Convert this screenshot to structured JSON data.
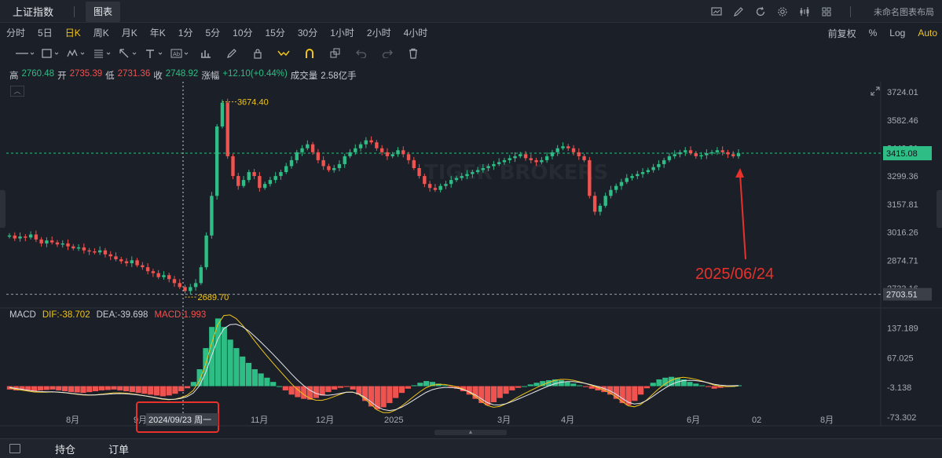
{
  "titlebar": {
    "app_title": "上证指数",
    "tab_chart": "图表",
    "layout_name": "未命名图表布局",
    "icons": [
      "screenshot-icon",
      "edit-icon",
      "refresh-icon",
      "settings-icon",
      "indicator-icon",
      "grid-icon"
    ]
  },
  "periods": {
    "items": [
      "分时",
      "5日",
      "日K",
      "周K",
      "月K",
      "年K",
      "1分",
      "5分",
      "10分",
      "15分",
      "30分",
      "1小时",
      "2小时",
      "4小时"
    ],
    "active": "日K",
    "adjust": "前复权",
    "percent": "%",
    "log": "Log",
    "auto": "Auto"
  },
  "quote": {
    "high_label": "高",
    "high": "2760.48",
    "open_label": "开",
    "open": "2735.39",
    "low_label": "低",
    "low": "2731.36",
    "close_label": "收",
    "close": "2748.92",
    "change_label": "涨幅",
    "change": "+12.10(+0.44%)",
    "volume_label": "成交量",
    "volume": "2.58亿手"
  },
  "macd": {
    "title": "MACD",
    "dif": "DIF:-38.702",
    "dea": "DEA:-39.698",
    "macd": "MACD:1.993"
  },
  "chart_data": {
    "type": "candlestick",
    "price_axis_ticks": [
      "3724.01",
      "3582.46",
      "3440.91",
      "3299.36",
      "3157.81",
      "3016.26",
      "2874.71",
      "2733.16"
    ],
    "price_ylim": [
      2690,
      3760
    ],
    "current_price_label": "3415.08",
    "low_line_label": "2703.51",
    "high_annotation": "3674.40",
    "low_annotation": "2689.70",
    "macd_axis_ticks": [
      "137.189",
      "67.025",
      "-3.138",
      "-73.302"
    ],
    "macd_ylim": [
      -90,
      170
    ],
    "time_axis_labels": [
      "8月",
      "9月",
      "11月",
      "12月",
      "2025",
      "3月",
      "4月",
      "6月",
      "02",
      "8月"
    ],
    "crosshair_date": "2024/09/23 周一",
    "annotation_text": "2025/06/24",
    "watermark": "TIGER BROKERS",
    "price_series": [
      3000,
      2985,
      2995,
      2990,
      3005,
      2980,
      2960,
      2975,
      2965,
      2955,
      2960,
      2945,
      2935,
      2940,
      2925,
      2920,
      2915,
      2925,
      2905,
      2895,
      2880,
      2870,
      2860,
      2875,
      2850,
      2840,
      2820,
      2810,
      2790,
      2800,
      2780,
      2760,
      2740,
      2720,
      2740,
      2760,
      2840,
      3000,
      3200,
      3550,
      3670,
      3400,
      3300,
      3250,
      3280,
      3320,
      3300,
      3240,
      3260,
      3280,
      3300,
      3320,
      3350,
      3380,
      3420,
      3440,
      3460,
      3420,
      3380,
      3350,
      3330,
      3340,
      3360,
      3400,
      3420,
      3440,
      3460,
      3480,
      3470,
      3440,
      3420,
      3400,
      3410,
      3430,
      3410,
      3380,
      3340,
      3300,
      3260,
      3240,
      3230,
      3250,
      3260,
      3280,
      3290,
      3300,
      3310,
      3320,
      3330,
      3340,
      3350,
      3360,
      3370,
      3380,
      3390,
      3400,
      3410,
      3390,
      3380,
      3370,
      3380,
      3400,
      3420,
      3440,
      3450,
      3440,
      3420,
      3400,
      3380,
      3200,
      3120,
      3150,
      3200,
      3230,
      3250,
      3270,
      3290,
      3300,
      3310,
      3320,
      3330,
      3345,
      3360,
      3380,
      3400,
      3410,
      3420,
      3430,
      3415,
      3400,
      3405,
      3415,
      3420,
      3430,
      3420,
      3410,
      3400,
      3415
    ],
    "macd_series": [
      -8,
      -10,
      -9,
      -11,
      -12,
      -10,
      -9,
      -8,
      -10,
      -12,
      -14,
      -15,
      -16,
      -14,
      -12,
      -10,
      -9,
      -8,
      -10,
      -12,
      -14,
      -16,
      -18,
      -20,
      -22,
      -24,
      -22,
      -18,
      -12,
      -5,
      10,
      40,
      90,
      140,
      160,
      140,
      110,
      90,
      70,
      55,
      40,
      30,
      20,
      10,
      0,
      -10,
      -20,
      -26,
      -30,
      -32,
      -28,
      -22,
      -14,
      -8,
      -4,
      -2,
      -8,
      -20,
      -35,
      -48,
      -55,
      -50,
      -40,
      -28,
      -16,
      -6,
      2,
      8,
      12,
      10,
      6,
      2,
      -2,
      -6,
      -12,
      -20,
      -30,
      -40,
      -45,
      -38,
      -28,
      -18,
      -10,
      -4,
      0,
      4,
      8,
      12,
      14,
      16,
      14,
      10,
      6,
      2,
      -2,
      -6,
      -10,
      -14,
      -20,
      -30,
      -40,
      -45,
      -35,
      -20,
      -5,
      8,
      16,
      20,
      22,
      20,
      16,
      10,
      6,
      2,
      -2,
      -6,
      -4,
      -2,
      0,
      2
    ]
  }
}
